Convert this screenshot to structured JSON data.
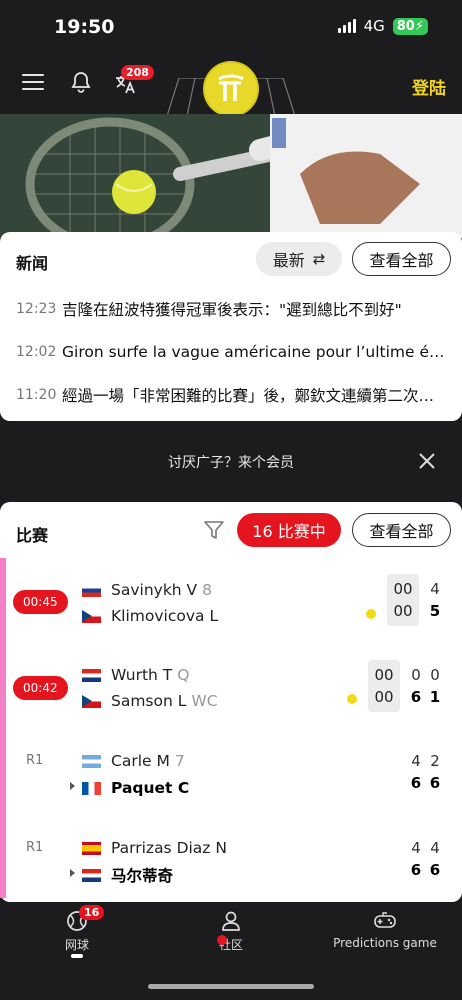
{
  "status_bar": {
    "time": "19:50",
    "network": "4G",
    "battery": "80"
  },
  "header": {
    "notification_count": "208",
    "login_label": "登陆"
  },
  "news": {
    "title": "新闻",
    "sort_label": "最新",
    "view_all_label": "查看全部",
    "items": [
      {
        "time": "12:23",
        "text": "吉隆在紐波特獲得冠軍後表示：\"遲到總比不到好\""
      },
      {
        "time": "12:02",
        "text": "Giron surfe la vague américaine pour l’ultime édition de Newport"
      },
      {
        "time": "11:20",
        "text": "經過一場「非常困難的比賽」後，鄭欽文連續第二次晉級溫網"
      }
    ]
  },
  "ad_bar": {
    "text": "讨厌广子？来个会员"
  },
  "matches": {
    "title": "比赛",
    "live_label": "16 比赛中",
    "view_all_label": "查看全部",
    "items": [
      {
        "time": "00:45",
        "p1": {
          "name": "Savinykh V",
          "seed": "8",
          "flag": "ru"
        },
        "p2": {
          "name": "Klimovicova L",
          "seed": "",
          "flag": "cz"
        },
        "points": [
          "00",
          "00"
        ],
        "sets1": [
          "4"
        ],
        "sets2": [
          "5"
        ]
      },
      {
        "time": "00:42",
        "p1": {
          "name": "Wurth T",
          "seed": "Q",
          "flag": "hr"
        },
        "p2": {
          "name": "Samson L",
          "seed": "WC",
          "flag": "cz"
        },
        "points": [
          "00",
          "00"
        ],
        "sets1": [
          "0",
          "0"
        ],
        "sets2": [
          "6",
          "1"
        ]
      },
      {
        "round": "R1",
        "p1": {
          "name": "Carle M",
          "seed": "7",
          "flag": "ar"
        },
        "p2": {
          "name": "Paquet C",
          "seed": "",
          "flag": "fr"
        },
        "sets1": [
          "4",
          "2"
        ],
        "sets2": [
          "6",
          "6"
        ]
      },
      {
        "round": "R1",
        "p1": {
          "name": "Parrizas Diaz N",
          "seed": "",
          "flag": "es"
        },
        "p2": {
          "name": "马尔蒂奇",
          "seed": "",
          "flag": "hr"
        },
        "sets1": [
          "4",
          "4"
        ],
        "sets2": [
          "6",
          "6"
        ]
      }
    ]
  },
  "bottom_nav": {
    "tennis_label": "网球",
    "tennis_badge": "16",
    "community_label": "社区",
    "predictions_label": "Predictions game"
  },
  "colors": {
    "accent_red": "#e5151f",
    "brand_yellow": "#f2d41a",
    "live_strip": "#f47fc6"
  }
}
